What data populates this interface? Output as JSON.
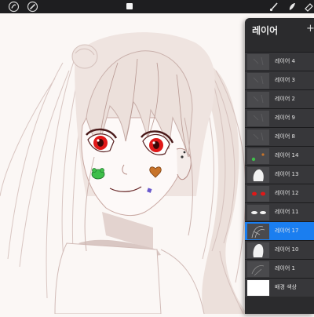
{
  "toolbar": {
    "left_icons": [
      "adjustments-icon",
      "selection-icon"
    ],
    "right_icons": [
      "brush-icon",
      "smudge-icon",
      "eraser-icon"
    ]
  },
  "layers_panel": {
    "title": "레이어",
    "add_icon": "plus-icon",
    "layers": [
      {
        "name": "레이어 4",
        "active": false,
        "thumb": "blank"
      },
      {
        "name": "레이어 3",
        "active": false,
        "thumb": "blank"
      },
      {
        "name": "레이어 2",
        "active": false,
        "thumb": "blank"
      },
      {
        "name": "레이어 9",
        "active": false,
        "thumb": "blank"
      },
      {
        "name": "레이어 8",
        "active": false,
        "thumb": "blank"
      },
      {
        "name": "레이어 14",
        "active": false,
        "thumb": "dots"
      },
      {
        "name": "레이어 13",
        "active": false,
        "thumb": "white-shape"
      },
      {
        "name": "레이어 12",
        "active": false,
        "thumb": "red-eyes"
      },
      {
        "name": "레이어 11",
        "active": false,
        "thumb": "white-eyes"
      },
      {
        "name": "레이어 17",
        "active": true,
        "thumb": "sketch"
      },
      {
        "name": "레이어 10",
        "active": false,
        "thumb": "white-figure"
      },
      {
        "name": "레이어 1",
        "active": false,
        "thumb": "sketch-dark"
      },
      {
        "name": "배경 색상",
        "active": false,
        "thumb": "white-bg"
      }
    ]
  },
  "colors": {
    "toolbar_bg": "#1e1e20",
    "panel_bg": "#2b2b2d",
    "active_layer": "#1a7ef0",
    "line_art": "#8a2a2a",
    "hair": "#ede0db",
    "eye_red": "#e01818"
  }
}
